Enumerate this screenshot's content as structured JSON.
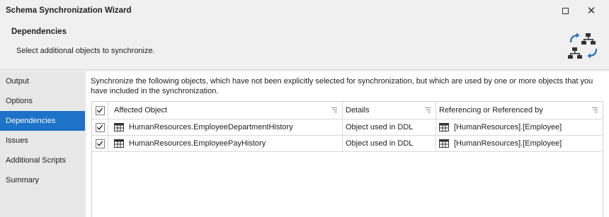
{
  "window": {
    "title": "Schema Synchronization Wizard",
    "maximize_icon": "maximize-icon",
    "close_icon": "close-icon",
    "close_glyph": "✕"
  },
  "header": {
    "title": "Dependencies",
    "subtitle": "Select additional objects to synchronize.",
    "icon": "schema-sync-icon"
  },
  "sidebar": {
    "items": [
      {
        "label": "Output",
        "active": false
      },
      {
        "label": "Options",
        "active": false
      },
      {
        "label": "Dependencies",
        "active": true
      },
      {
        "label": "Issues",
        "active": false
      },
      {
        "label": "Additional Scripts",
        "active": false
      },
      {
        "label": "Summary",
        "active": false
      }
    ]
  },
  "main": {
    "description": "Synchronize the following objects, which have not been explicitly selected for synchronization, but which are used by one or more objects that you have included in the synchronization.",
    "grid": {
      "header_checked": true,
      "columns": [
        "Affected Object",
        "Details",
        "Referencing or Referenced by"
      ],
      "rows": [
        {
          "checked": true,
          "object": "HumanResources.EmployeeDepartmentHistory",
          "details": "Object used in DDL",
          "reference": "[HumanResources].[Employee]"
        },
        {
          "checked": true,
          "object": "HumanResources.EmployeePayHistory",
          "details": "Object used in DDL",
          "reference": "[HumanResources].[Employee]"
        }
      ]
    }
  },
  "colors": {
    "accent": "#1e73c8",
    "icon_blue": "#1e6fc0",
    "icon_dark": "#333333"
  }
}
